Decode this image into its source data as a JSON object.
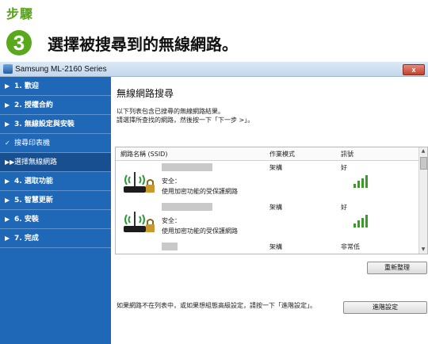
{
  "header": {
    "step_label": "步驟",
    "step_number": "3",
    "title": "選擇被搜尋到的無線網路。"
  },
  "window": {
    "title": "Samsung ML-2160 Series",
    "close_label": "x"
  },
  "sidebar": {
    "items": [
      {
        "prefix": "▶",
        "label": "1. 歡迎"
      },
      {
        "prefix": "▶",
        "label": "2. 授權合約"
      },
      {
        "prefix": "▶",
        "label": "3. 無線設定與安裝"
      },
      {
        "prefix": "✓",
        "label": "搜尋印表機"
      },
      {
        "prefix": "▶▶",
        "label": "選擇無線網路"
      },
      {
        "prefix": "▶",
        "label": "4. 選取功能"
      },
      {
        "prefix": "▶",
        "label": "5. 智慧更新"
      },
      {
        "prefix": "▶",
        "label": "6. 安裝"
      },
      {
        "prefix": "▶",
        "label": "7. 完成"
      }
    ]
  },
  "content": {
    "heading": "無線網路搜尋",
    "desc1": "以下列表包含已搜尋的無線網路結果。",
    "desc2": "請選擇所查找的網路，然後按一下「下一步 >」。",
    "table": {
      "col_ssid": "網路名稱 (SSID)",
      "col_mode": "作業模式",
      "col_signal": "訊號",
      "rows": [
        {
          "mode": "架構",
          "signal": "好",
          "security_label": "安全：",
          "security_desc": "使用加密功能的受保護網路"
        },
        {
          "mode": "架構",
          "signal": "好",
          "security_label": "安全：",
          "security_desc": "使用加密功能的受保護網路"
        },
        {
          "mode": "架構",
          "signal": "非常低",
          "security_label": "",
          "security_desc": ""
        }
      ]
    },
    "refresh_button": "重新整理",
    "bottom_note": "如果網路不在列表中，或如果想組態高級設定，請按一下「進階設定」。",
    "advanced_button": "進階設定"
  },
  "colors": {
    "accent_green": "#5aa91c",
    "sidebar_blue": "#1f67b7",
    "signal_green": "#3a9a2a"
  }
}
